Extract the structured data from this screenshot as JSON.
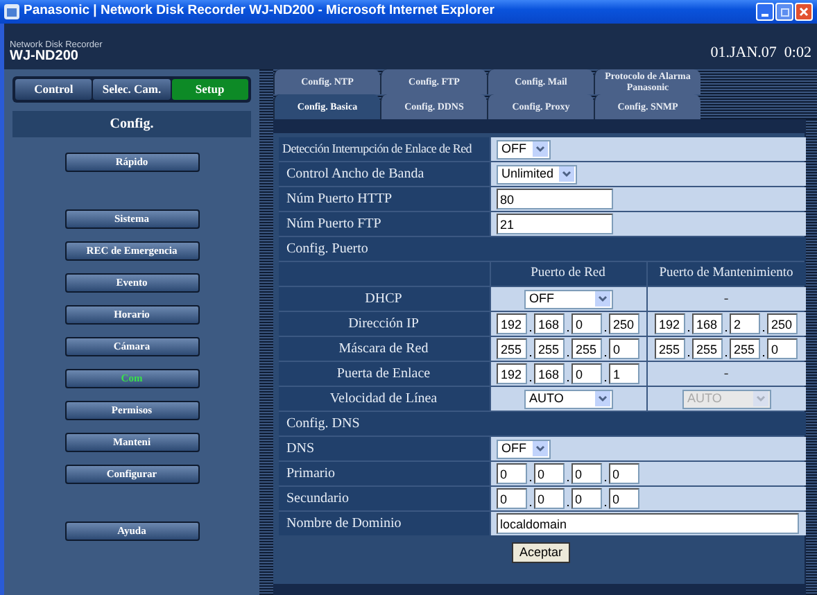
{
  "browser": {
    "title": "Panasonic | Network Disk Recorder WJ-ND200 - Microsoft Internet Explorer"
  },
  "header": {
    "subtitle": "Network Disk Recorder",
    "model": "WJ-ND200",
    "datetime": "01.JAN.07  0:02"
  },
  "nav_tabs": [
    {
      "label": "Control",
      "selected": false
    },
    {
      "label": "Selec. Cam.",
      "selected": false
    },
    {
      "label": "Setup",
      "selected": true
    }
  ],
  "sidebar": {
    "title": "Config.",
    "items": [
      {
        "label": "Rápido",
        "selected": false,
        "gap_before": false
      },
      {
        "label": "Sistema",
        "selected": false,
        "gap_before": true
      },
      {
        "label": "REC de Emergencia",
        "selected": false,
        "gap_before": false
      },
      {
        "label": "Evento",
        "selected": false,
        "gap_before": false
      },
      {
        "label": "Horario",
        "selected": false,
        "gap_before": false
      },
      {
        "label": "Cámara",
        "selected": false,
        "gap_before": false
      },
      {
        "label": "Com",
        "selected": true,
        "gap_before": false
      },
      {
        "label": "Permisos",
        "selected": false,
        "gap_before": false
      },
      {
        "label": "Manteni",
        "selected": false,
        "gap_before": false
      },
      {
        "label": "Configurar",
        "selected": false,
        "gap_before": false
      },
      {
        "label": "Ayuda",
        "selected": false,
        "gap_before": true
      }
    ]
  },
  "tab_rows": [
    [
      {
        "label": "Config. NTP",
        "selected": false
      },
      {
        "label": "Config. FTP",
        "selected": false
      },
      {
        "label": "Config. Mail",
        "selected": false
      },
      {
        "label": "Protocolo de Alarma Panasonic",
        "selected": false
      }
    ],
    [
      {
        "label": "Config. Basica",
        "selected": true
      },
      {
        "label": "Config. DDNS",
        "selected": false
      },
      {
        "label": "Config. Proxy",
        "selected": false
      },
      {
        "label": "Config. SNMP",
        "selected": false
      }
    ]
  ],
  "settings": [
    {
      "kind": "select",
      "label": "Detección Interrupción de Enlace de Red",
      "value": "OFF"
    },
    {
      "kind": "select",
      "label": "Control Ancho de Banda",
      "value": "Unlimited"
    },
    {
      "kind": "text",
      "label": "Núm Puerto HTTP",
      "value": "80"
    },
    {
      "kind": "text",
      "label": "Núm Puerto FTP",
      "value": "21"
    },
    {
      "kind": "section",
      "label": "Config. Puerto"
    },
    {
      "kind": "columns",
      "columns": [
        "Puerto de Red",
        "Puerto de Mantenimiento"
      ]
    },
    {
      "kind": "port",
      "label": "DHCP",
      "cells": [
        {
          "kind": "select",
          "value": "OFF",
          "disabled": false
        },
        {
          "kind": "dash",
          "value": "-"
        }
      ]
    },
    {
      "kind": "port",
      "label": "Dirección IP",
      "cells": [
        {
          "kind": "ip",
          "octets": [
            "192",
            "168",
            "0",
            "250"
          ]
        },
        {
          "kind": "ip",
          "octets": [
            "192",
            "168",
            "2",
            "250"
          ]
        }
      ]
    },
    {
      "kind": "port",
      "label": "Máscara de Red",
      "cells": [
        {
          "kind": "ip",
          "octets": [
            "255",
            "255",
            "255",
            "0"
          ]
        },
        {
          "kind": "ip",
          "octets": [
            "255",
            "255",
            "255",
            "0"
          ]
        }
      ]
    },
    {
      "kind": "port",
      "label": "Puerta de Enlace",
      "cells": [
        {
          "kind": "ip",
          "octets": [
            "192",
            "168",
            "0",
            "1"
          ]
        },
        {
          "kind": "dash",
          "value": "-"
        }
      ]
    },
    {
      "kind": "port",
      "label": "Velocidad de Línea",
      "cells": [
        {
          "kind": "select",
          "value": "AUTO",
          "disabled": false
        },
        {
          "kind": "select",
          "value": "AUTO",
          "disabled": true
        }
      ]
    },
    {
      "kind": "section",
      "label": "Config. DNS"
    },
    {
      "kind": "select",
      "label": "DNS",
      "value": "OFF"
    },
    {
      "kind": "ip",
      "label": "Primario",
      "octets": [
        "0",
        "0",
        "0",
        "0"
      ]
    },
    {
      "kind": "ip",
      "label": "Secundario",
      "octets": [
        "0",
        "0",
        "0",
        "0"
      ]
    },
    {
      "kind": "text",
      "label": "Nombre de Dominio",
      "value": "localdomain",
      "wide": true
    }
  ],
  "submit": "Aceptar"
}
